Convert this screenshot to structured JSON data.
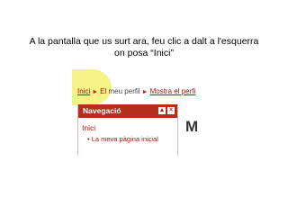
{
  "instruction": {
    "line1": "A la pantalla que us surt ara, feu clic a dalt a l'esquerra",
    "line2": "on posa “Inici”"
  },
  "screenshot": {
    "breadcrumb": {
      "home": "Inici",
      "separator": "►",
      "middle_first": "El",
      "middle_rest": " meu perfil",
      "last": "Mostra el perfi"
    },
    "navigation": {
      "title": "Navegació",
      "collapse_icon": "▲",
      "close_icon": "×",
      "home_item": "Inici",
      "sub_item": "• La meva pàgina inicial"
    },
    "main_heading_partial": "M"
  },
  "colors": {
    "accent": "#b52e1c",
    "link": "#b0100b",
    "highlight": "#f4f17a"
  }
}
